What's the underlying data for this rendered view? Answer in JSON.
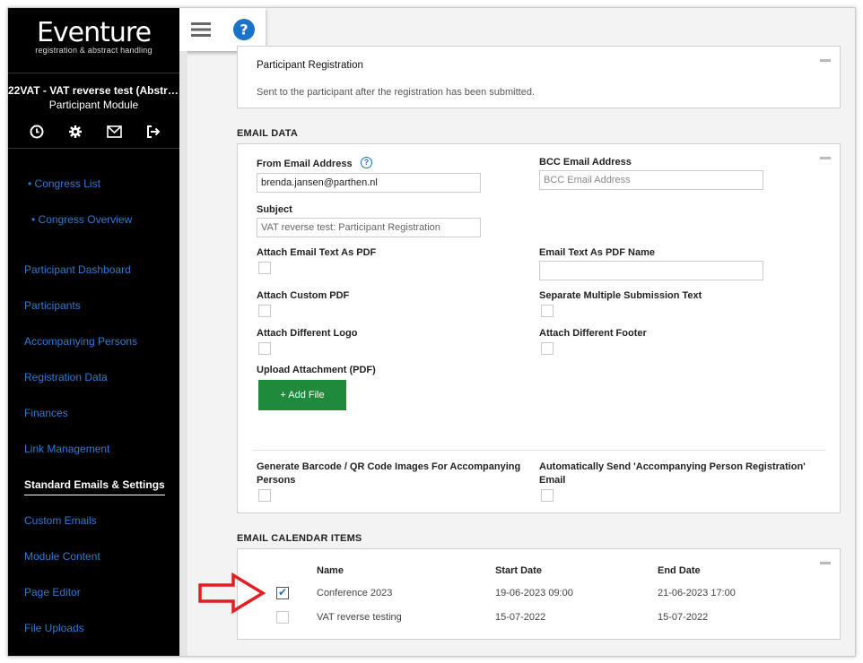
{
  "brand": {
    "name": "Eventure",
    "tagline": "registration & abstract handling"
  },
  "congress": {
    "title": "22VAT - VAT reverse test (Abstract...",
    "module": "Participant Module"
  },
  "side_icons": [
    "clock-icon",
    "gear-icon",
    "envelope-icon",
    "logout-icon"
  ],
  "nav": {
    "sub_items": [
      "Congress List",
      "Congress Overview"
    ],
    "items": [
      "Participant Dashboard",
      "Participants",
      "Accompanying Persons",
      "Registration Data",
      "Finances",
      "Link Management",
      "Standard Emails & Settings",
      "Custom Emails",
      "Module Content",
      "Page Editor",
      "File Uploads"
    ],
    "active": "Standard Emails & Settings"
  },
  "topbar": {
    "menu_icon": "hamburger-icon",
    "help_icon": "help-icon"
  },
  "email_header": {
    "title": "Participant Registration",
    "description": "Sent to the participant after the registration has been submitted."
  },
  "email_data": {
    "heading": "EMAIL DATA",
    "from_label": "From Email Address",
    "from_value": "brenda.jansen@parthen.nl",
    "bcc_label": "BCC Email Address",
    "bcc_placeholder": "BCC Email Address",
    "subject_label": "Subject",
    "subject_value": "VAT reverse test: Participant Registration",
    "attach_pdf_label": "Attach Email Text As PDF",
    "pdf_name_label": "Email Text As PDF Name",
    "custom_pdf_label": "Attach Custom PDF",
    "separate_text_label": "Separate Multiple Submission Text",
    "diff_logo_label": "Attach Different Logo",
    "diff_footer_label": "Attach Different Footer",
    "upload_label": "Upload Attachment (PDF)",
    "add_file_label": "+ Add File",
    "barcode_label": "Generate Barcode / QR Code Images For Accompanying Persons",
    "auto_send_label": "Automatically Send 'Accompanying Person Registration' Email"
  },
  "calendar": {
    "heading": "EMAIL CALENDAR ITEMS",
    "columns": [
      "Name",
      "Start Date",
      "End Date"
    ],
    "rows": [
      {
        "name": "Conference 2023",
        "start": "19-06-2023 09:00",
        "end": "21-06-2023 17:00",
        "checked": true
      },
      {
        "name": "VAT reverse testing",
        "start": "15-07-2022",
        "end": "15-07-2022",
        "checked": false
      }
    ]
  },
  "colors": {
    "sidebar_bg": "#000000",
    "nav_link": "#2e7bd6",
    "accent_green": "#1f8a3b",
    "arrow_red": "#e02020",
    "help_blue": "#1a73c8"
  }
}
